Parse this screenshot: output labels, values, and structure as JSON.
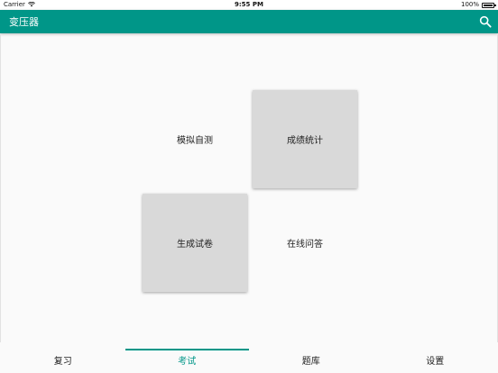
{
  "status_bar": {
    "carrier": "Carrier",
    "time": "9:55 PM",
    "battery": "100%"
  },
  "app_bar": {
    "title": "变压器",
    "background_color": "#009688",
    "search_icon": "search-icon"
  },
  "grid": {
    "tiles": [
      {
        "label": "模拟自测",
        "raised": false
      },
      {
        "label": "成绩统计",
        "raised": true
      },
      {
        "label": "生成试卷",
        "raised": true
      },
      {
        "label": "在线问答",
        "raised": false
      }
    ]
  },
  "tab_bar": {
    "active_index": 1,
    "active_color": "#009688",
    "tabs": [
      {
        "label": "复习"
      },
      {
        "label": "考试"
      },
      {
        "label": "题库"
      },
      {
        "label": "设置"
      }
    ]
  }
}
